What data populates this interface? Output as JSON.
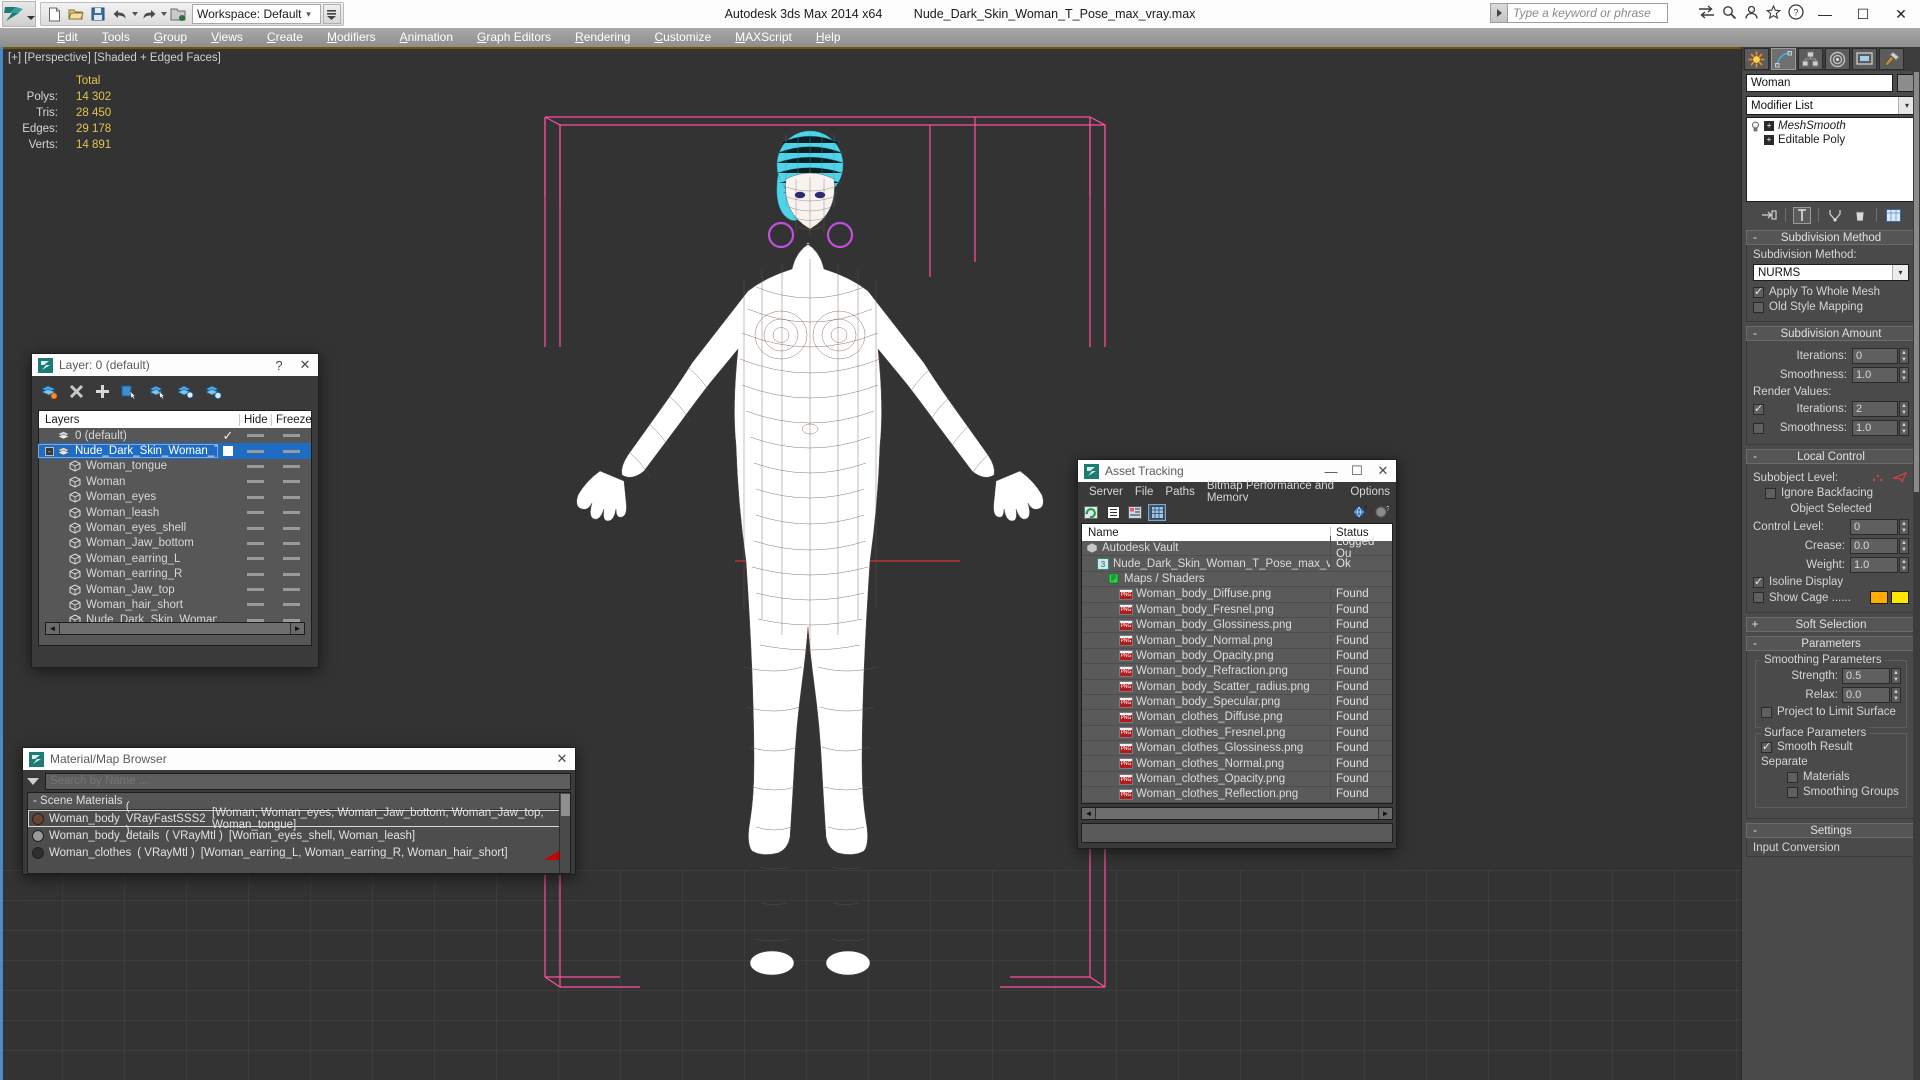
{
  "titlebar": {
    "app_title": "Autodesk 3ds Max  2014 x64",
    "file_name": "Nude_Dark_Skin_Woman_T_Pose_max_vray.max",
    "workspace_label": "Workspace: Default",
    "search_placeholder": "Type a keyword or phrase",
    "window_buttons": {
      "minimize": "—",
      "maximize": "☐",
      "close": "✕"
    }
  },
  "menubar": {
    "items": [
      {
        "label": "Edit",
        "accel": "E"
      },
      {
        "label": "Tools",
        "accel": "T"
      },
      {
        "label": "Group",
        "accel": "G"
      },
      {
        "label": "Views",
        "accel": "V"
      },
      {
        "label": "Create",
        "accel": "C"
      },
      {
        "label": "Modifiers",
        "accel": "M"
      },
      {
        "label": "Animation",
        "accel": "A"
      },
      {
        "label": "Graph Editors",
        "accel": "G"
      },
      {
        "label": "Rendering",
        "accel": "R"
      },
      {
        "label": "Customize",
        "accel": "C"
      },
      {
        "label": "MAXScript",
        "accel": "M"
      },
      {
        "label": "Help",
        "accel": "H"
      }
    ]
  },
  "viewport": {
    "label": "[+] [Perspective] [Shaded + Edged Faces]",
    "stats_header": "Total",
    "stats": [
      {
        "label": "Polys:",
        "value": "14 302"
      },
      {
        "label": "Tris:",
        "value": "28 450"
      },
      {
        "label": "Edges:",
        "value": "29 178"
      },
      {
        "label": "Verts:",
        "value": "14 891"
      }
    ]
  },
  "layer_dialog": {
    "title": "Layer: 0 (default)",
    "help_btn": "?",
    "close_btn": "✕",
    "columns": {
      "layers": "Layers",
      "hide": "Hide",
      "freeze": "Freeze"
    },
    "rows": [
      {
        "name": "0 (default)",
        "indent": 0,
        "icon": "layer-icon",
        "selected": false,
        "check": "✓",
        "expander": ""
      },
      {
        "name": "Nude_Dark_Skin_Woman_T_Pose",
        "indent": 0,
        "icon": "layer-icon",
        "selected": true,
        "check": "box",
        "expander": "-"
      },
      {
        "name": "Woman_tongue",
        "indent": 1,
        "icon": "object-icon",
        "selected": false,
        "check": "",
        "expander": ""
      },
      {
        "name": "Woman",
        "indent": 1,
        "icon": "object-icon",
        "selected": false,
        "check": "",
        "expander": ""
      },
      {
        "name": "Woman_eyes",
        "indent": 1,
        "icon": "object-icon",
        "selected": false,
        "check": "",
        "expander": ""
      },
      {
        "name": "Woman_leash",
        "indent": 1,
        "icon": "object-icon",
        "selected": false,
        "check": "",
        "expander": ""
      },
      {
        "name": "Woman_eyes_shell",
        "indent": 1,
        "icon": "object-icon",
        "selected": false,
        "check": "",
        "expander": ""
      },
      {
        "name": "Woman_Jaw_bottom",
        "indent": 1,
        "icon": "object-icon",
        "selected": false,
        "check": "",
        "expander": ""
      },
      {
        "name": "Woman_earring_L",
        "indent": 1,
        "icon": "object-icon",
        "selected": false,
        "check": "",
        "expander": ""
      },
      {
        "name": "Woman_earring_R",
        "indent": 1,
        "icon": "object-icon",
        "selected": false,
        "check": "",
        "expander": ""
      },
      {
        "name": "Woman_Jaw_top",
        "indent": 1,
        "icon": "object-icon",
        "selected": false,
        "check": "",
        "expander": ""
      },
      {
        "name": "Woman_hair_short",
        "indent": 1,
        "icon": "object-icon",
        "selected": false,
        "check": "",
        "expander": ""
      },
      {
        "name": "Nude_Dark_Skin_Woman_T_Pose",
        "indent": 1,
        "icon": "object-icon",
        "selected": false,
        "check": "",
        "expander": ""
      }
    ]
  },
  "asset_tracking": {
    "title": "Asset Tracking",
    "window_buttons": {
      "minimize": "—",
      "maximize": "☐",
      "close": "✕"
    },
    "menu": [
      "Server",
      "File",
      "Paths",
      "Bitmap Performance and Memory",
      "Options"
    ],
    "columns": {
      "name": "Name",
      "status": "Status"
    },
    "rows": [
      {
        "name": "Autodesk Vault",
        "status": "Logged Ou",
        "indent": 0,
        "icon": "vault-icon"
      },
      {
        "name": "Nude_Dark_Skin_Woman_T_Pose_max_vray.max",
        "status": "Ok",
        "indent": 1,
        "icon": "max-icon"
      },
      {
        "name": "Maps / Shaders",
        "status": "",
        "indent": 2,
        "icon": "maps-icon"
      },
      {
        "name": "Woman_body_Diffuse.png",
        "status": "Found",
        "indent": 3,
        "icon": "png-icon"
      },
      {
        "name": "Woman_body_Fresnel.png",
        "status": "Found",
        "indent": 3,
        "icon": "png-icon"
      },
      {
        "name": "Woman_body_Glossiness.png",
        "status": "Found",
        "indent": 3,
        "icon": "png-icon"
      },
      {
        "name": "Woman_body_Normal.png",
        "status": "Found",
        "indent": 3,
        "icon": "png-icon"
      },
      {
        "name": "Woman_body_Opacity.png",
        "status": "Found",
        "indent": 3,
        "icon": "png-icon"
      },
      {
        "name": "Woman_body_Refraction.png",
        "status": "Found",
        "indent": 3,
        "icon": "png-icon"
      },
      {
        "name": "Woman_body_Scatter_radius.png",
        "status": "Found",
        "indent": 3,
        "icon": "png-icon"
      },
      {
        "name": "Woman_body_Specular.png",
        "status": "Found",
        "indent": 3,
        "icon": "png-icon"
      },
      {
        "name": "Woman_clothes_Diffuse.png",
        "status": "Found",
        "indent": 3,
        "icon": "png-icon"
      },
      {
        "name": "Woman_clothes_Fresnel.png",
        "status": "Found",
        "indent": 3,
        "icon": "png-icon"
      },
      {
        "name": "Woman_clothes_Glossiness.png",
        "status": "Found",
        "indent": 3,
        "icon": "png-icon"
      },
      {
        "name": "Woman_clothes_Normal.png",
        "status": "Found",
        "indent": 3,
        "icon": "png-icon"
      },
      {
        "name": "Woman_clothes_Opacity.png",
        "status": "Found",
        "indent": 3,
        "icon": "png-icon"
      },
      {
        "name": "Woman_clothes_Reflection.png",
        "status": "Found",
        "indent": 3,
        "icon": "png-icon"
      }
    ]
  },
  "material_browser": {
    "title": "Material/Map Browser",
    "close_btn": "✕",
    "search_placeholder": "Search by Name ...",
    "group_label": "- Scene Materials",
    "materials": [
      {
        "name": "Woman_body",
        "type": "( VRayFastSSS2 )",
        "objects": "[Woman, Woman_eyes, Woman_Jaw_bottom, Woman_Jaw_top, Woman_tongue]",
        "swatch": "#6b4434",
        "selected": true
      },
      {
        "name": "Woman_body_details",
        "type": "( VRayMtl )",
        "objects": "[Woman_eyes_shell, Woman_leash]",
        "swatch": "#9a9a9a",
        "selected": false
      },
      {
        "name": "Woman_clothes",
        "type": "( VRayMtl )",
        "objects": "[Woman_earring_L, Woman_earring_R, Woman_hair_short]",
        "swatch": "#2e2e2e",
        "selected": false
      }
    ]
  },
  "command_panel": {
    "object_name": "Woman",
    "modifier_list_label": "Modifier List",
    "modifier_stack": [
      {
        "label": "MeshSmooth",
        "italic": true,
        "has_bulb": true
      },
      {
        "label": "Editable Poly",
        "italic": false,
        "has_bulb": false
      }
    ],
    "rollouts": {
      "subdivision_method": {
        "title": "Subdivision Method",
        "sign": "-",
        "field_label": "Subdivision Method:",
        "value": "NURMS",
        "checkboxes": [
          {
            "label": "Apply To Whole Mesh",
            "checked": true
          },
          {
            "label": "Old Style Mapping",
            "checked": false
          }
        ]
      },
      "subdivision_amount": {
        "title": "Subdivision Amount",
        "sign": "-",
        "iterations_label": "Iterations:",
        "iterations_value": "0",
        "smoothness_label": "Smoothness:",
        "smoothness_value": "1.0",
        "render_values_label": "Render Values:",
        "render_iterations_label": "Iterations:",
        "render_iterations_value": "2",
        "render_iterations_checked": true,
        "render_smoothness_label": "Smoothness:",
        "render_smoothness_value": "1.0",
        "render_smoothness_checked": false
      },
      "local_control": {
        "title": "Local Control",
        "sign": "-",
        "subobject_label": "Subobject Level:",
        "ignore_backfacing": "Ignore Backfacing",
        "ignore_backfacing_checked": false,
        "object_selected": "Object Selected",
        "control_level_label": "Control Level:",
        "control_level_value": "0",
        "crease_label": "Crease:",
        "crease_value": "0.0",
        "weight_label": "Weight:",
        "weight_value": "1.0",
        "isoline_display": "Isoline Display",
        "isoline_checked": true,
        "show_cage": "Show Cage ......",
        "show_cage_checked": false,
        "cage_color_1": "#ffab00",
        "cage_color_2": "#ffe800"
      },
      "soft_selection": {
        "title": "Soft Selection",
        "sign": "+"
      },
      "parameters": {
        "title": "Parameters",
        "sign": "-",
        "smoothing_group": "Smoothing Parameters",
        "strength_label": "Strength:",
        "strength_value": "0.5",
        "relax_label": "Relax:",
        "relax_value": "0.0",
        "project_label": "Project to Limit Surface",
        "project_checked": false,
        "surface_group": "Surface Parameters",
        "smooth_result": "Smooth Result",
        "smooth_result_checked": true,
        "separate_label": "Separate",
        "materials_label": "Materials",
        "materials_checked": false,
        "smoothing_groups_label": "Smoothing Groups",
        "smoothing_groups_checked": false
      },
      "settings": {
        "title": "Settings",
        "sign": "-",
        "input_conversion": "Input Conversion"
      }
    }
  }
}
